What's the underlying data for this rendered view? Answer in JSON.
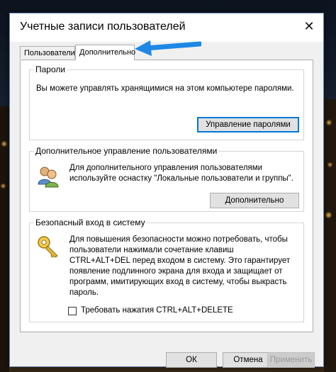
{
  "dialog": {
    "title": "Учетные записи пользователей",
    "close_glyph": "✕"
  },
  "tabs": [
    {
      "label": "Пользователи",
      "active": false
    },
    {
      "label": "Дополнительно",
      "active": true
    }
  ],
  "passwords": {
    "legend": "Пароли",
    "description": "Вы можете управлять хранящимися на этом компьютере паролями.",
    "button_label": "Управление паролями"
  },
  "advanced_users": {
    "legend": "Дополнительное управление пользователями",
    "description": "Для дополнительного управления пользователями используйте оснастку \"Локальные пользователи и группы\".",
    "button_label": "Дополнительно",
    "icon": "users-icon"
  },
  "secure_logon": {
    "legend": "Безопасный вход в систему",
    "description": "Для повышения безопасности можно потребовать, чтобы пользователи нажимали сочетание клавиш CTRL+ALT+DEL перед входом в систему. Это гарантирует появление подлинного экрана для входа и защищает от программ, имитирующих вход в систему, чтобы выкрасть пароль.",
    "checkbox_label": "Требовать нажатия CTRL+ALT+DELETE",
    "checkbox_checked": false,
    "icon": "key-icon"
  },
  "footer": {
    "ok_label": "ОК",
    "cancel_label": "Отмена",
    "apply_label": "Применить"
  },
  "annotation": {
    "arrow_color": "#1e88e5"
  }
}
